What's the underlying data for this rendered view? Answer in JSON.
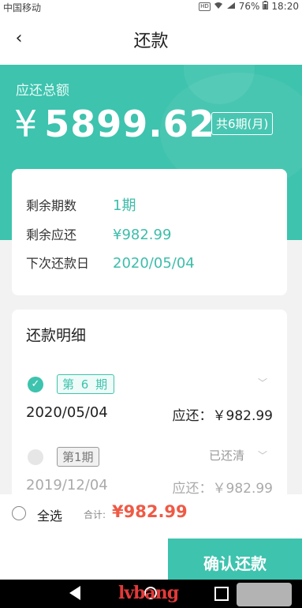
{
  "statusbar": {
    "carrier": "中国移动",
    "hd": "HD",
    "signal": "ᴴᴰ",
    "battery": "76%",
    "time": "18:20"
  },
  "navbar": {
    "back_icon": "‹",
    "title": "还款"
  },
  "hero": {
    "label": "应还总额",
    "currency": "¥",
    "amount": "5899.62",
    "period_badge": "共6期(月)"
  },
  "summary": {
    "rows": [
      {
        "key": "剩余期数",
        "value": "1期"
      },
      {
        "key": "剩余应还",
        "value": "¥982.99"
      },
      {
        "key": "下次还款日",
        "value": "2020/05/04"
      }
    ]
  },
  "detail": {
    "title": "还款明细",
    "items": [
      {
        "check": "✓",
        "tag": "第 6 期",
        "chevron": "﹀",
        "date": "2020/05/04",
        "due": "应还：￥982.99",
        "status": ""
      },
      {
        "tag": "第1期",
        "status": "已还清",
        "chevron": "﹀",
        "date": "2019/12/04",
        "due": "应还：￥982.99"
      }
    ]
  },
  "footer": {
    "select_all": "全选",
    "total_label": "合计:",
    "total_value": "¥982.99",
    "confirm": "确认还款"
  },
  "watermark": "lvbang",
  "colors": {
    "accent": "#3dc3ae",
    "total": "#ef5a45"
  }
}
